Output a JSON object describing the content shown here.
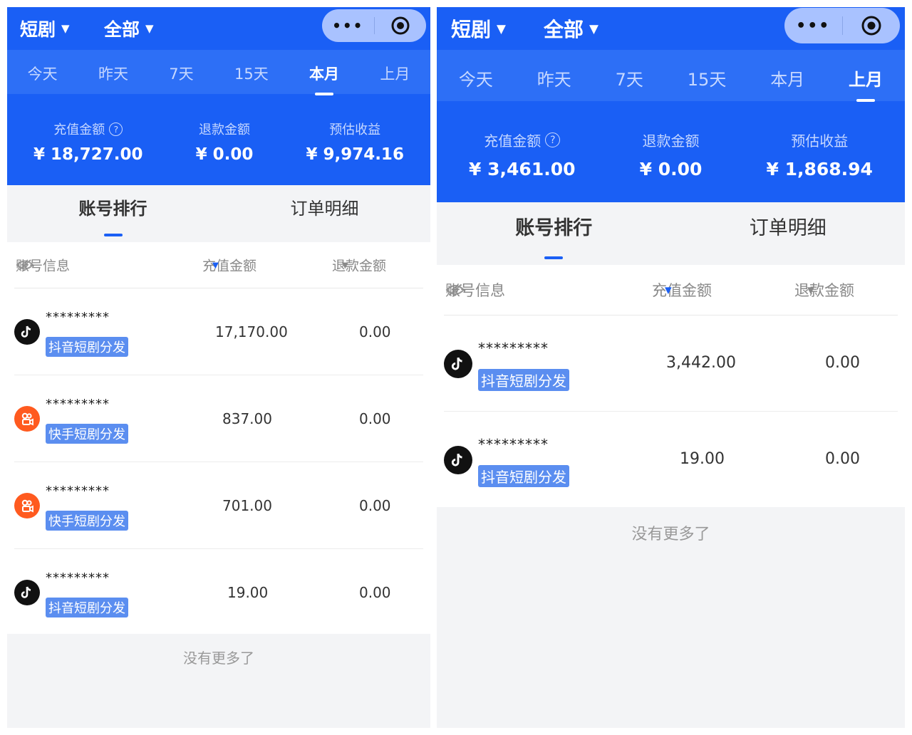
{
  "left": {
    "header": {
      "category": "短剧",
      "filter": "全部",
      "more_label": "•••"
    },
    "tabs": [
      "今天",
      "昨天",
      "7天",
      "15天",
      "本月",
      "上月"
    ],
    "active_tab": "本月",
    "stats": {
      "recharge_label": "充值金额",
      "recharge_value": "¥ 18,727.00",
      "refund_label": "退款金额",
      "refund_value": "¥ 0.00",
      "income_label": "预估收益",
      "income_value": "¥ 9,974.16"
    },
    "subtabs": [
      "账号排行",
      "订单明细"
    ],
    "table_header": {
      "account": "账号信息",
      "recharge": "充值金额",
      "refund": "退款金额"
    },
    "rows": [
      {
        "platform": "douyin",
        "account": "*********",
        "tag": "抖音短剧分发",
        "recharge": "17,170.00",
        "refund": "0.00"
      },
      {
        "platform": "kuaishou",
        "account": "*********",
        "tag": "快手短剧分发",
        "recharge": "837.00",
        "refund": "0.00"
      },
      {
        "platform": "kuaishou",
        "account": "*********",
        "tag": "快手短剧分发",
        "recharge": "701.00",
        "refund": "0.00"
      },
      {
        "platform": "douyin",
        "account": "*********",
        "tag": "抖音短剧分发",
        "recharge": "19.00",
        "refund": "0.00"
      }
    ],
    "no_more": "没有更多了"
  },
  "right": {
    "header": {
      "category": "短剧",
      "filter": "全部",
      "more_label": "•••"
    },
    "tabs": [
      "今天",
      "昨天",
      "7天",
      "15天",
      "本月",
      "上月"
    ],
    "active_tab": "上月",
    "stats": {
      "recharge_label": "充值金额",
      "recharge_value": "¥ 3,461.00",
      "refund_label": "退款金额",
      "refund_value": "¥ 0.00",
      "income_label": "预估收益",
      "income_value": "¥ 1,868.94"
    },
    "subtabs": [
      "账号排行",
      "订单明细"
    ],
    "table_header": {
      "account": "账号信息",
      "recharge": "充值金额",
      "refund": "退款金额"
    },
    "rows": [
      {
        "platform": "douyin",
        "account": "*********",
        "tag": "抖音短剧分发",
        "recharge": "3,442.00",
        "refund": "0.00"
      },
      {
        "platform": "douyin",
        "account": "*********",
        "tag": "抖音短剧分发",
        "recharge": "19.00",
        "refund": "0.00"
      }
    ],
    "no_more": "没有更多了"
  },
  "colors": {
    "primary": "#1a5ff5",
    "douyin": "#111111",
    "kuaishou": "#ff5a1f",
    "badge": "#5b8ef0"
  },
  "icons": {
    "dropdown": "caret-down-icon",
    "more": "more-dots-icon",
    "target": "target-icon",
    "help": "help-circle-icon",
    "eye": "eye-off-icon",
    "douyin": "douyin-logo-icon",
    "kuaishou": "kuaishou-logo-icon"
  }
}
